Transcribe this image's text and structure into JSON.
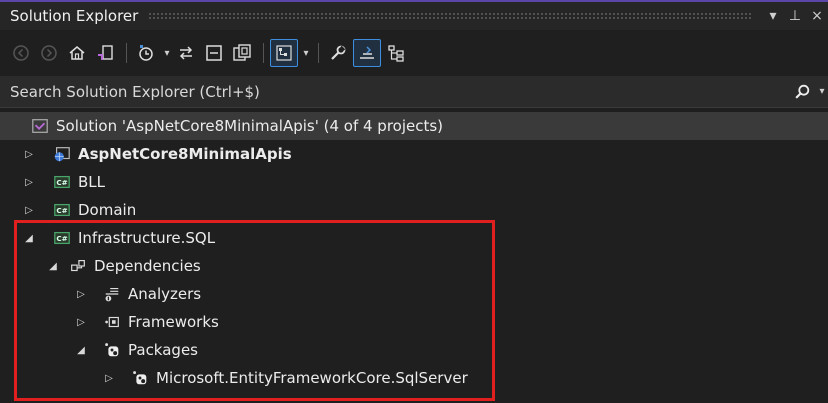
{
  "window": {
    "title": "Solution Explorer",
    "pin_glyph": "▾",
    "pin_glyph2": "⊥",
    "close_glyph": "×"
  },
  "toolbar": {
    "dropdown_glyph": "▾"
  },
  "search": {
    "placeholder": "Search Solution Explorer (Ctrl+$)",
    "dropdown_glyph": "▾"
  },
  "tree": {
    "solution_label": "Solution 'AspNetCore8MinimalApis' (4 of 4 projects)",
    "items": [
      {
        "label": "AspNetCore8MinimalApis",
        "expander": "▷"
      },
      {
        "label": "BLL",
        "expander": "▷"
      },
      {
        "label": "Domain",
        "expander": "▷"
      },
      {
        "label": "Infrastructure.SQL",
        "expander": "◢"
      },
      {
        "label": "Dependencies",
        "expander": "◢"
      },
      {
        "label": "Analyzers",
        "expander": "▷"
      },
      {
        "label": "Frameworks",
        "expander": "▷"
      },
      {
        "label": "Packages",
        "expander": "◢"
      },
      {
        "label": "Microsoft.EntityFrameworkCore.SqlServer",
        "expander": "▷"
      }
    ]
  },
  "colors": {
    "highlight": "#e0201f",
    "accent": "#3d8ee0",
    "csharp": "#4aa56a"
  }
}
